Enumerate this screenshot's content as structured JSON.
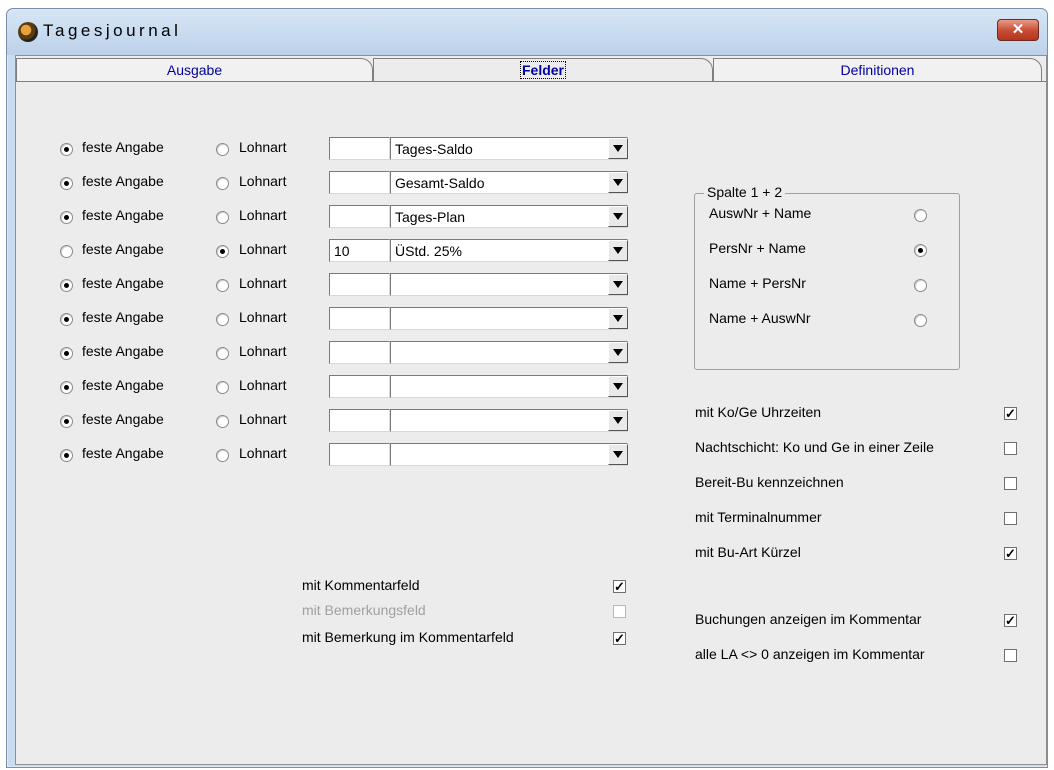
{
  "window": {
    "title": "Tagesjournal",
    "close_symbol": "✕"
  },
  "tabs": [
    {
      "label": "Ausgabe",
      "active": false
    },
    {
      "label": "Felder",
      "active": true
    },
    {
      "label": "Definitionen",
      "active": false
    }
  ],
  "field_rows": [
    {
      "feste_angabe": true,
      "lohnart": false,
      "code": "",
      "name": "Tages-Saldo"
    },
    {
      "feste_angabe": true,
      "lohnart": false,
      "code": "",
      "name": "Gesamt-Saldo"
    },
    {
      "feste_angabe": true,
      "lohnart": false,
      "code": "",
      "name": "Tages-Plan"
    },
    {
      "feste_angabe": false,
      "lohnart": true,
      "code": "10",
      "name": "ÜStd. 25%"
    },
    {
      "feste_angabe": true,
      "lohnart": false,
      "code": "",
      "name": ""
    },
    {
      "feste_angabe": true,
      "lohnart": false,
      "code": "",
      "name": ""
    },
    {
      "feste_angabe": true,
      "lohnart": false,
      "code": "",
      "name": ""
    },
    {
      "feste_angabe": true,
      "lohnart": false,
      "code": "",
      "name": ""
    },
    {
      "feste_angabe": true,
      "lohnart": false,
      "code": "",
      "name": ""
    },
    {
      "feste_angabe": true,
      "lohnart": false,
      "code": "",
      "name": ""
    }
  ],
  "labels": {
    "feste_angabe": "feste Angabe",
    "lohnart": "Lohnart"
  },
  "spalte": {
    "title": "Spalte 1 + 2",
    "options": [
      {
        "label": "AuswNr + Name",
        "selected": false
      },
      {
        "label": "PersNr + Name",
        "selected": true
      },
      {
        "label": "Name + PersNr",
        "selected": false
      },
      {
        "label": "Name + AuswNr",
        "selected": false
      }
    ]
  },
  "right_checks": [
    {
      "label": "mit Ko/Ge Uhrzeiten",
      "checked": true
    },
    {
      "label": "Nachtschicht: Ko und Ge in einer Zeile",
      "checked": false
    },
    {
      "label": "Bereit-Bu kennzeichnen",
      "checked": false
    },
    {
      "label": "mit Terminalnummer",
      "checked": false
    },
    {
      "label": "mit Bu-Art Kürzel",
      "checked": true
    }
  ],
  "comment_checks": [
    {
      "label": "Buchungen anzeigen im Kommentar",
      "checked": true
    },
    {
      "label": "alle LA <> 0 anzeigen im Kommentar",
      "checked": false
    }
  ],
  "bottom_checks": [
    {
      "label": "mit Kommentarfeld",
      "checked": true,
      "disabled": false
    },
    {
      "label": "mit Bemerkungsfeld",
      "checked": false,
      "disabled": true
    },
    {
      "label": "mit Bemerkung im Kommentarfeld",
      "checked": true,
      "disabled": false
    }
  ],
  "check_mark": "✓"
}
